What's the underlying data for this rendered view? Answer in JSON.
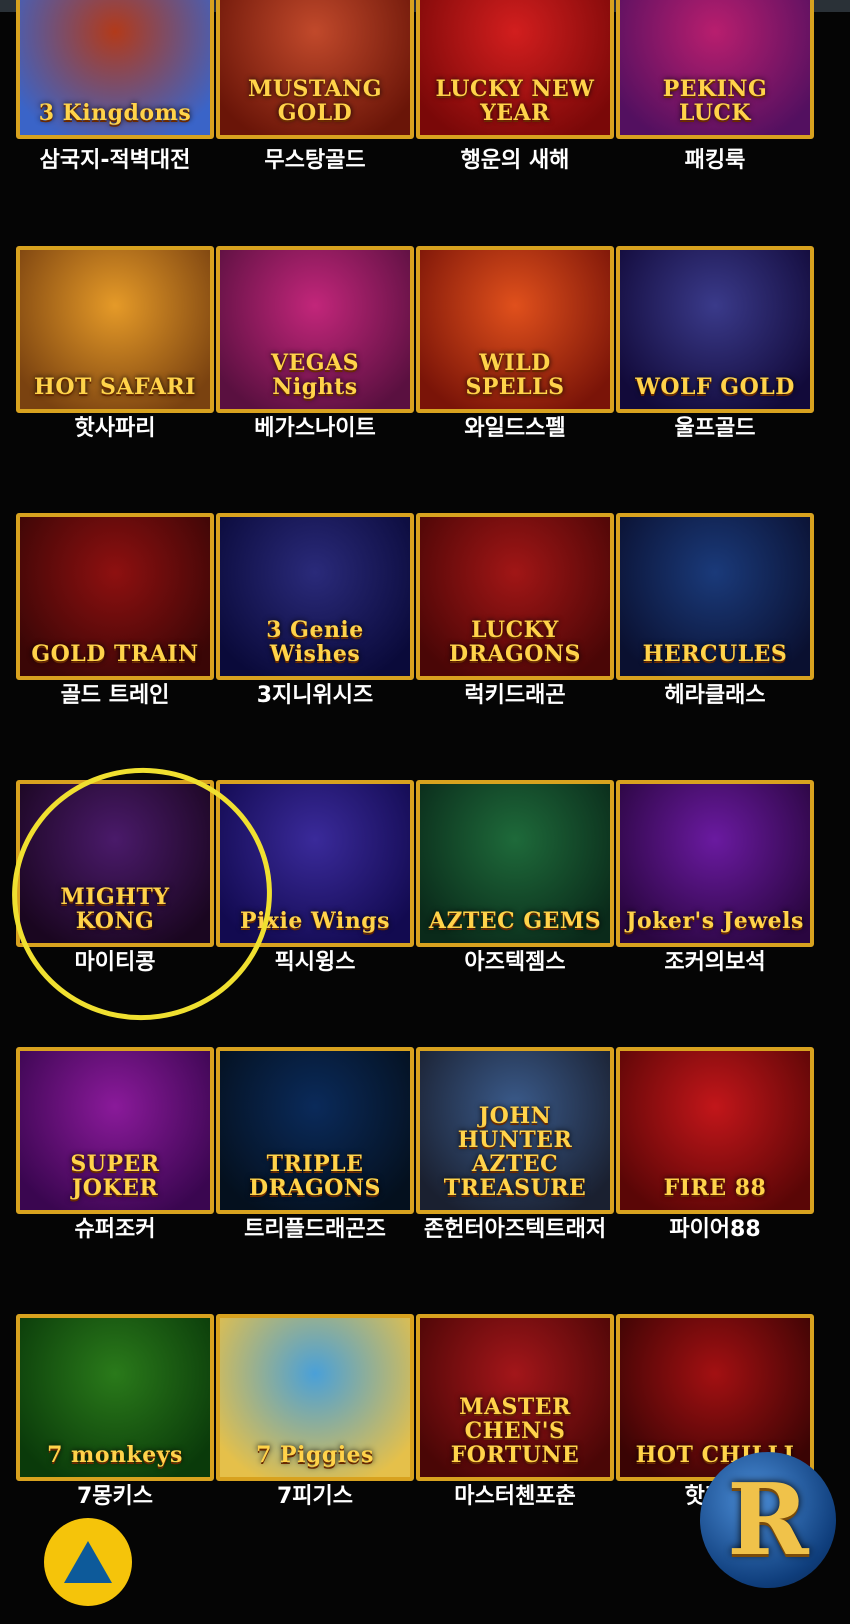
{
  "games": [
    {
      "logo": "3 Kingdoms",
      "label": "삼국지-적벽대전",
      "bg": [
        "#b23a1a",
        "#3a64c8"
      ]
    },
    {
      "logo": "MUSTANG GOLD",
      "label": "무스탕골드",
      "bg": [
        "#c1492b",
        "#6a1508"
      ]
    },
    {
      "logo": "LUCKY NEW YEAR",
      "label": "행운의 새해",
      "bg": [
        "#d21e1e",
        "#7a0808"
      ]
    },
    {
      "logo": "PEKING LUCK",
      "label": "패킹룩",
      "bg": [
        "#b81e6e",
        "#531060"
      ]
    },
    {
      "logo": "HOT SAFARI",
      "label": "핫사파리",
      "bg": [
        "#e59a28",
        "#7a4210"
      ]
    },
    {
      "logo": "VEGAS Nights",
      "label": "베가스나이트",
      "bg": [
        "#c2267a",
        "#5a1040"
      ]
    },
    {
      "logo": "WILD SPELLS",
      "label": "와일드스펠",
      "bg": [
        "#e0501c",
        "#7a1408"
      ]
    },
    {
      "logo": "WOLF GOLD",
      "label": "울프골드",
      "bg": [
        "#3a3a8a",
        "#120a3a"
      ]
    },
    {
      "logo": "GOLD TRAIN",
      "label": "골드 트레인",
      "bg": [
        "#8e1010",
        "#3a0606"
      ]
    },
    {
      "logo": "3 Genie Wishes",
      "label": "3지니위시즈",
      "bg": [
        "#2a2a7a",
        "#0a0a3a"
      ]
    },
    {
      "logo": "LUCKY DRAGONS",
      "label": "럭키드래곤",
      "bg": [
        "#a11616",
        "#4a0606"
      ]
    },
    {
      "logo": "HERCULES",
      "label": "헤라클래스",
      "bg": [
        "#1a3a7a",
        "#0a1030"
      ]
    },
    {
      "logo": "MIGHTY KONG",
      "label": "마이티콩",
      "bg": [
        "#4a1a6a",
        "#1a0620"
      ]
    },
    {
      "logo": "Pixie Wings",
      "label": "픽시윙스",
      "bg": [
        "#3a2a9a",
        "#120a50"
      ]
    },
    {
      "logo": "AZTEC GEMS",
      "label": "아즈텍젬스",
      "bg": [
        "#1e6a3a",
        "#0a2a1a"
      ]
    },
    {
      "logo": "Joker's Jewels",
      "label": "조커의보석",
      "bg": [
        "#6a1aa0",
        "#2a0640"
      ]
    },
    {
      "logo": "SUPER JOKER",
      "label": "슈퍼조커",
      "bg": [
        "#8a1a9a",
        "#3a0650"
      ]
    },
    {
      "logo": "TRIPLE DRAGONS",
      "label": "트리플드래곤즈",
      "bg": [
        "#0a2a5a",
        "#04101e"
      ]
    },
    {
      "logo": "JOHN HUNTER AZTEC TREASURE",
      "label": "존헌터아즈텍트래저",
      "bg": [
        "#3a5a8a",
        "#1a2030"
      ]
    },
    {
      "logo": "FIRE 88",
      "label": "파이어88",
      "bg": [
        "#c2161a",
        "#5a0606"
      ]
    },
    {
      "logo": "7 monkeys",
      "label": "7몽키스",
      "bg": [
        "#2a7a1a",
        "#0a3a0a"
      ]
    },
    {
      "logo": "7 Piggies",
      "label": "7피기스",
      "bg": [
        "#4aa0d8",
        "#e5c04a"
      ]
    },
    {
      "logo": "MASTER CHEN'S FORTUNE",
      "label": "마스터첸포춘",
      "bg": [
        "#a3161a",
        "#4a0606"
      ]
    },
    {
      "logo": "HOT CHILLI",
      "label": "핫칠리",
      "bg": [
        "#a31012",
        "#3a0404"
      ]
    }
  ],
  "fab": {
    "icon": "up-arrow-icon",
    "color": "#f5c40a"
  },
  "badge": {
    "letter": "R"
  },
  "highlight_color": "#f0e030"
}
